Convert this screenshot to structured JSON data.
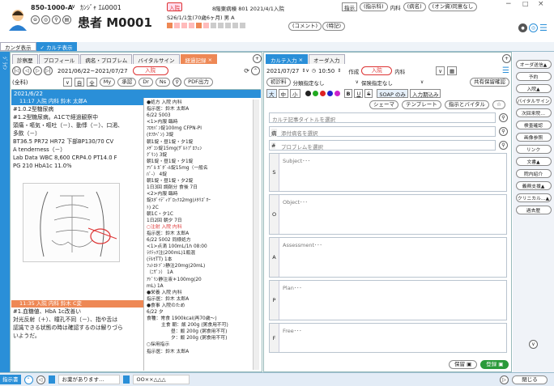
{
  "patient": {
    "id": "850-1000-A",
    "kana": "ｶﾝｼﾞｬ ｴﾑ0001",
    "name": "患者 M0001",
    "dob": "S26/1/1生(70歳6ヶ月) 男 A",
    "status": "入院",
    "ward": "8階東病棟 801 2021/4/1入院",
    "tags": [
      "指示",
      "(指示科)",
      "内科",
      "(病名)",
      "(オン資)同意なし"
    ],
    "comment": "(コメント)",
    "note": "(特記)"
  },
  "top_tabs": [
    "カンダ表示",
    "✓ カルテ表示"
  ],
  "left_pane": {
    "tabs": [
      "診察歴",
      "プロフィール",
      "病名・プロブレム",
      "バイタルサイン",
      "経過記録"
    ],
    "date_range": "2021/06/22~2021/07/27",
    "status_btn": "入院",
    "filter": "(全科)",
    "buttons": [
      "My",
      "承認",
      "Dr",
      "Ns",
      "PDF出力"
    ],
    "date_header": "2021/6/22",
    "entry1_header": "11:17 入院 内科 鈴木 太郎A",
    "entry1_lines": [
      "#1.0.2型糖尿病",
      "#1.2型糖尿病。A1Cで経過観察中",
      "頭痛・嘔気・嘔吐（－）、動悸（－）、口渇、",
      "多飲（－）",
      "BT36.5 PR72 HR72 下部BP130/70 CV",
      "A tenderness（－）",
      "Lab Data WBC 8,600 CRP4.0 PT14.0 F",
      "PG 210 HbA1c 11.0%"
    ],
    "entry2_header": "11:35 入院 内科 鈴木 C変",
    "entry2_lines": [
      "#1.血糖値、HbA 1c改善い",
      "対光反射（＋）、瞳孔不同（－）、指や舌は",
      "認識できる状態の時は確認するのは解りづら",
      "いようだ。"
    ],
    "rx_lines": [
      "●処方        入院 内科",
      "指示医：鈴木 太郎A",
      "6/22  5003",
      "<1>内服 臨時",
      "ﾌﾛﾓﾊﾟﾝ錠100mg CFPN-PI",
      "(ｾﾌｶﾍﾟﾝ)               3錠",
      "朝1錠・昼1錠・夕1錠",
      "ﾒﾁﾞｺﾝ錠15mg(ｻﾞﾙﾄﾌﾟﾛﾌｪﾝ",
      "ｸﾞﾘﾝ)                  3錠",
      "朝1錠・昼1錠・夕1錠",
      "ｱｿﾞﾙ ｶﾞﾀﾞ-ﾙ錠15mg（一般名",
      "ﾊﾞ-）                  4錠",
      "朝1錠・昼1錠・夕2錠",
      "1日3回 調剤分 食後      7日",
      "<2>内服 臨時",
      "錠ｽﾀﾞｲﾃﾞｨｸﾞﾛｯｸｽ2mg(ﾒﾀﾘｽﾞｵｰ",
      "ﾄ)                     2C",
      "朝1C・夕1C",
      "1日2回 朝夕             7日",
      "○注射        入院 内科",
      "指示医：鈴木 太郎A",
      "6/22  5002  同様処方",
      "<1>点滴 100mL/1h 08:00",
      "ﾗｸﾃｯｸ注(200mL)1瓶混",
      "(ﾃﾙﾓTT)               1本",
      "ﾌｪﾄﾛﾄｿﾞﾝ静注20mg(20mL)",
      "（ﾆｻﾞﾝ）              1A",
      "ｱﾄﾞﾘﾝ静注液＊100mg(20",
      "mL)                    1A",
      "●栄養        入院 内科",
      "指示医：鈴木 太郎A",
      "●食事        入院のため",
      "6/22  夕",
      "食種：常食  1900kcal(再70歳～)",
      "主食 朝：飯  200g (粥食用不可)",
      "昼：飯  200g (粥食用不可)",
      "夕：飯  200g (粥食用不可)",
      "○採用指示",
      "指示医：鈴木 太郎A"
    ]
  },
  "right_pane": {
    "tabs": [
      "カルテ入力",
      "オーダ入力"
    ],
    "date": "2021/07/27",
    "time": "10:50",
    "create_label": "作成",
    "status_btn": "入院",
    "dept": "内科",
    "first_visit": "初診料",
    "type1": "分類指定なし",
    "type2": "保険指定なし",
    "shared": "共有保留確認",
    "size_btns": [
      "大",
      "中",
      "小"
    ],
    "style_btns": [
      "B",
      "U",
      "S"
    ],
    "soap_label": "SOAP のみ",
    "input_period": "入力期込み",
    "schema_btn": "シェーマ",
    "template_btn": "テンプレート",
    "vital_btn": "指示とバイタル",
    "search_title": "カルテ記事タイトルを選択",
    "search_disease": "添付病名を選択",
    "search_problem": "プロブレムを選択",
    "soap": [
      {
        "key": "S",
        "placeholder": "Subject･･･"
      },
      {
        "key": "O",
        "placeholder": "Object･･･"
      },
      {
        "key": "A",
        "placeholder": "Assessment･･･"
      },
      {
        "key": "P",
        "placeholder": "Plan･･･"
      },
      {
        "key": "F",
        "placeholder": "Free･･･"
      }
    ],
    "save_btn": "保留",
    "approve_btn": "登録"
  },
  "side": {
    "items": [
      "オーダ送信▲",
      "予約",
      "入院▲",
      "バイタルサイン",
      "次回来院…",
      "検査確認",
      "画像参照",
      "リンク",
      "文書▲",
      "院内紹介",
      "義務支援▲",
      "クリニカル…▲",
      "過去歴"
    ],
    "close": "閉じる"
  },
  "status": {
    "label": "指示書",
    "item1": "お薬があります…",
    "item2": "OO××△△△"
  },
  "colors": {
    "accent": "#2a8fd8",
    "status_red": "#d33",
    "tab_orange": "#e85"
  }
}
